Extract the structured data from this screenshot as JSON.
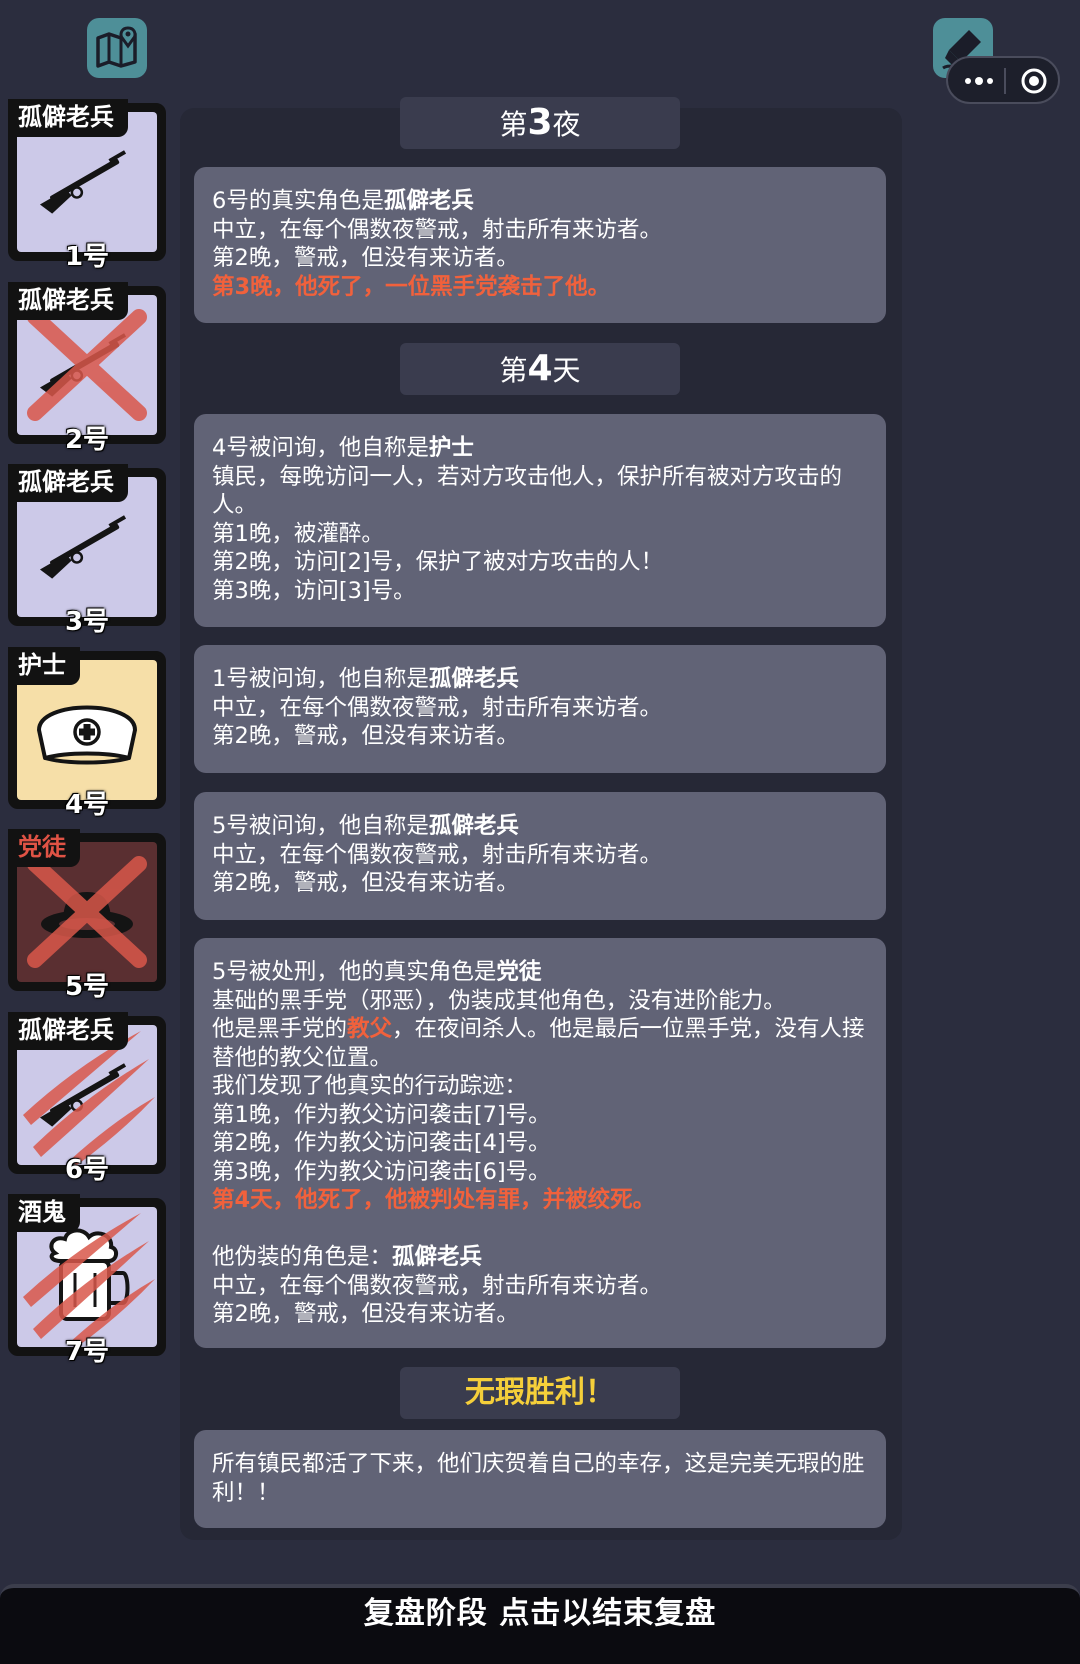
{
  "toolbar": {
    "map_icon": "map-pin-icon",
    "edit_icon": "marker-pen-icon",
    "capsule": {
      "more_icon": "more-dots-icon",
      "close_icon": "target-circle-icon"
    }
  },
  "players": [
    {
      "role": "孤僻老兵",
      "number": "1号",
      "icon": "rifle-icon",
      "status": "alive",
      "role_color": "#ffffff"
    },
    {
      "role": "孤僻老兵",
      "number": "2号",
      "icon": "rifle-icon",
      "status": "crossed-out",
      "role_color": "#ffffff"
    },
    {
      "role": "孤僻老兵",
      "number": "3号",
      "icon": "rifle-icon",
      "status": "alive",
      "role_color": "#ffffff"
    },
    {
      "role": "护士",
      "number": "4号",
      "icon": "nurse-cap-icon",
      "status": "alive",
      "role_color": "#ffffff"
    },
    {
      "role": "党徒",
      "number": "5号",
      "icon": "hat-icon",
      "status": "crossed-out",
      "role_color": "#e05345"
    },
    {
      "role": "孤僻老兵",
      "number": "6号",
      "icon": "rifle-icon",
      "status": "clawed",
      "role_color": "#ffffff"
    },
    {
      "role": "酒鬼",
      "number": "7号",
      "icon": "beer-mug-icon",
      "status": "clawed",
      "role_color": "#ffffff"
    }
  ],
  "log": {
    "night3": {
      "prefix": "第",
      "num": "3",
      "suffix": "夜"
    },
    "box1": {
      "l1a": "6号的真实角色是",
      "l1b": "孤僻老兵",
      "l2": "中立，在每个偶数夜警戒，射击所有来访者。",
      "l3": "第2晚，警戒，但没有来访者。",
      "l4": "第3晚，他死了，一位黑手党袭击了他。"
    },
    "day4": {
      "prefix": "第",
      "num": "4",
      "suffix": "天"
    },
    "box2": {
      "l1a": "4号被问询，他自称是",
      "l1b": "护士",
      "l2": "镇民，每晚访问一人，若对方攻击他人，保护所有被对方攻击的人。",
      "l3": "第1晚，被灌醉。",
      "l4": "第2晚，访问[2]号，保护了被对方攻击的人！",
      "l5": "第3晚，访问[3]号。"
    },
    "box3": {
      "l1a": "1号被问询，他自称是",
      "l1b": "孤僻老兵",
      "l2": "中立，在每个偶数夜警戒，射击所有来访者。",
      "l3": "第2晚，警戒，但没有来访者。"
    },
    "box4": {
      "l1a": "5号被问询，他自称是",
      "l1b": "孤僻老兵",
      "l2": "中立，在每个偶数夜警戒，射击所有来访者。",
      "l3": "第2晚，警戒，但没有来访者。"
    },
    "box5": {
      "l1a": "5号被处刑，他的真实角色是",
      "l1b": "党徒",
      "l2": "基础的黑手党（邪恶），伪装成其他角色，没有进阶能力。",
      "l3a": "他是黑手党的",
      "l3b": "教父",
      "l3c": "，在夜间杀人。他是最后一位黑手党，没有人接替他的教父位置。",
      "l4": "我们发现了他真实的行动踪迹：",
      "l5": "第1晚，作为教父访问袭击[7]号。",
      "l6": "第2晚，作为教父访问袭击[4]号。",
      "l7": "第3晚，作为教父访问袭击[6]号。",
      "l8": "第4天，他死了，他被判处有罪，并被绞死。",
      "l9a": "他伪装的角色是：",
      "l9b": "孤僻老兵",
      "l10": "中立，在每个偶数夜警戒，射击所有来访者。",
      "l11": "第2晚，警戒，但没有来访者。"
    },
    "victory": "无瑕胜利！",
    "box6": {
      "l1": "所有镇民都活了下来，他们庆贺着自己的幸存，这是完美无瑕的胜利！！"
    }
  },
  "bottom_bar": "复盘阶段 点击以结束复盘",
  "colors": {
    "background": "#2b2d3e",
    "panel": "#262836",
    "entry": "#616376",
    "header": "#3a3c4e",
    "highlight_red": "#f1613c",
    "victory_gold": "#f5cf3a",
    "accent_teal": "#4e8f98",
    "card_lavender": "#ccc9e8",
    "card_yellow": "#f6dfa8"
  }
}
